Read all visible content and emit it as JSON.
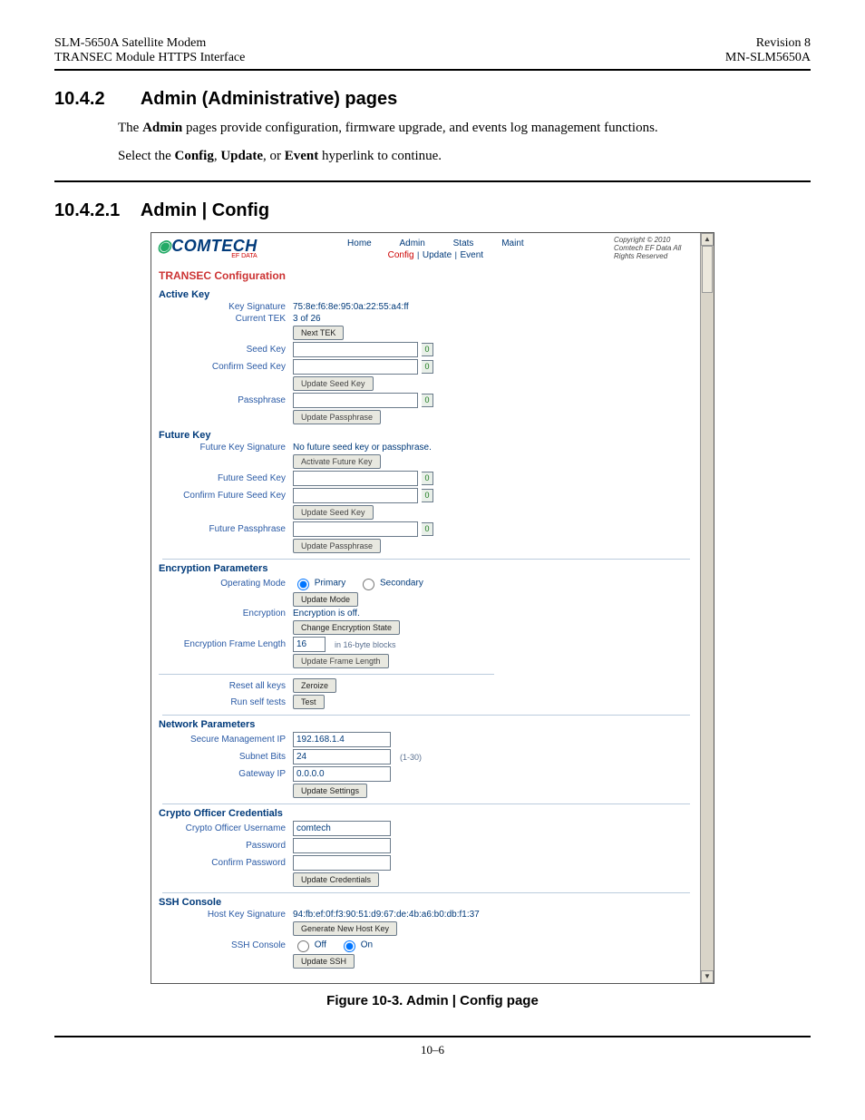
{
  "doc": {
    "left1": "SLM-5650A Satellite Modem",
    "left2": "TRANSEC Module HTTPS Interface",
    "right1": "Revision 8",
    "right2": "MN-SLM5650A",
    "page_num": "10–6",
    "s1_num": "10.4.2",
    "s1_title": "Admin (Administrative) pages",
    "p1_pre": "The ",
    "p1_b1": "Admin",
    "p1_post": " pages provide configuration, firmware upgrade, and events log management functions.",
    "p2_pre": "Select the ",
    "p2_b1": "Config",
    "p2_sep1": ", ",
    "p2_b2": "Update",
    "p2_sep2": ", or ",
    "p2_b3": "Event",
    "p2_post": " hyperlink to continue.",
    "s2_num": "10.4.2.1",
    "s2_title": "Admin | Config",
    "figure": "Figure 10-3. Admin | Config page"
  },
  "shot": {
    "logo_main": "COMTECH",
    "logo_sub": "EF DATA",
    "nav": {
      "home": "Home",
      "admin": "Admin",
      "stats": "Stats",
      "maint": "Maint"
    },
    "subnav": {
      "config": "Config",
      "update": "Update",
      "event": "Event",
      "sep": " | "
    },
    "copyright": "Copyright © 2010 Comtech EF Data All Rights Reserved",
    "page_title": "TRANSEC Configuration",
    "active": {
      "title": "Active Key",
      "key_sig_lbl": "Key Signature",
      "key_sig_val": "75:8e:f6:8e:95:0a:22:55:a4:ff",
      "cur_tek_lbl": "Current TEK",
      "cur_tek_val": "3 of 26",
      "next_tek_btn": "Next TEK",
      "seed_lbl": "Seed Key",
      "conf_seed_lbl": "Confirm Seed Key",
      "upd_seed_btn": "Update Seed Key",
      "pass_lbl": "Passphrase",
      "upd_pass_btn": "Update Passphrase",
      "counter": "0"
    },
    "future": {
      "title": "Future Key",
      "fsig_lbl": "Future Key Signature",
      "fsig_val": "No future seed key or passphrase.",
      "activate_btn": "Activate Future Key",
      "seed_lbl": "Future Seed Key",
      "conf_seed_lbl": "Confirm Future Seed Key",
      "upd_seed_btn": "Update Seed Key",
      "pass_lbl": "Future Passphrase",
      "upd_pass_btn": "Update Passphrase",
      "counter": "0"
    },
    "enc": {
      "title": "Encryption Parameters",
      "mode_lbl": "Operating Mode",
      "mode_primary": "Primary",
      "mode_secondary": "Secondary",
      "upd_mode_btn": "Update Mode",
      "enc_lbl": "Encryption",
      "enc_val": "Encryption is off.",
      "chg_btn": "Change Encryption State",
      "frame_lbl": "Encryption Frame Length",
      "frame_val": "16",
      "frame_hint": "in 16-byte blocks",
      "upd_frame_btn": "Update Frame Length",
      "reset_lbl": "Reset all keys",
      "reset_btn": "Zeroize",
      "test_lbl": "Run self tests",
      "test_btn": "Test"
    },
    "net": {
      "title": "Network Parameters",
      "ip_lbl": "Secure Management IP",
      "ip_val": "192.168.1.4",
      "subnet_lbl": "Subnet Bits",
      "subnet_val": "24",
      "subnet_hint": "(1-30)",
      "gw_lbl": "Gateway IP",
      "gw_val": "0.0.0.0",
      "upd_btn": "Update Settings"
    },
    "crypto": {
      "title": "Crypto Officer Credentials",
      "user_lbl": "Crypto Officer Username",
      "user_val": "comtech",
      "pass_lbl": "Password",
      "conf_lbl": "Confirm Password",
      "upd_btn": "Update Credentials"
    },
    "ssh": {
      "title": "SSH Console",
      "sig_lbl": "Host Key Signature",
      "sig_val": "94:fb:ef:0f:f3:90:51:d9:67:de:4b:a6:b0:db:f1:37",
      "gen_btn": "Generate New Host Key",
      "console_lbl": "SSH Console",
      "off": "Off",
      "on": "On",
      "upd_btn": "Update SSH"
    }
  }
}
